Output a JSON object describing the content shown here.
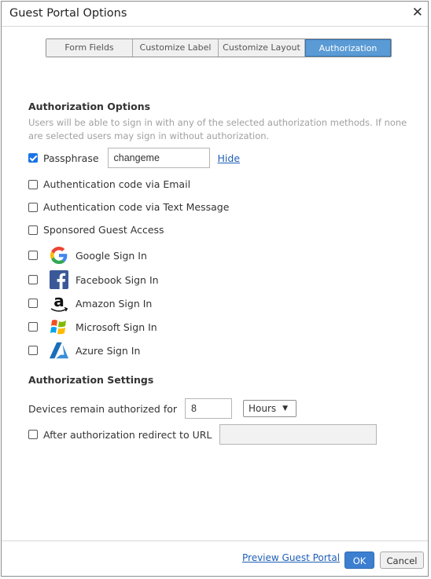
{
  "dialog": {
    "title": "Guest Portal Options"
  },
  "tabs": [
    {
      "label": "Form Fields"
    },
    {
      "label": "Customize Label"
    },
    {
      "label": "Customize Layout"
    },
    {
      "label": "Authorization",
      "active": true
    }
  ],
  "auth_options": {
    "title": "Authorization Options",
    "description": "Users will be able to sign in with any of the selected authorization methods. If none are selected users may sign in without authorization.",
    "passphrase": {
      "label": "Passphrase",
      "value": "changeme",
      "checked": true,
      "hide_label": "Hide"
    },
    "email": {
      "label": "Authentication code via Email",
      "checked": false
    },
    "sms": {
      "label": "Authentication code via Text Message",
      "checked": false
    },
    "sponsored": {
      "label": "Sponsored Guest Access",
      "checked": false
    },
    "google": {
      "label": "Google Sign In",
      "checked": false,
      "icon": "google-icon"
    },
    "facebook": {
      "label": "Facebook Sign In",
      "checked": false,
      "icon": "facebook-icon"
    },
    "amazon": {
      "label": "Amazon Sign In",
      "checked": false,
      "icon": "amazon-icon"
    },
    "microsoft": {
      "label": "Microsoft Sign In",
      "checked": false,
      "icon": "microsoft-icon"
    },
    "azure": {
      "label": "Azure Sign In",
      "checked": false,
      "icon": "azure-icon"
    }
  },
  "auth_settings": {
    "title": "Authorization Settings",
    "devices_label": "Devices remain authorized for",
    "devices_value": "8",
    "unit_selected": "Hours",
    "redirect_label": "After authorization redirect to URL",
    "redirect_checked": false,
    "redirect_value": ""
  },
  "footer": {
    "preview_label": "Preview Guest Portal",
    "ok_label": "OK",
    "cancel_label": "Cancel"
  },
  "colors": {
    "accent": "#5b9bd5",
    "link": "#1f5fb7",
    "ok_button": "#3c7fd0",
    "checkbox_checked": "#1a73e8"
  }
}
